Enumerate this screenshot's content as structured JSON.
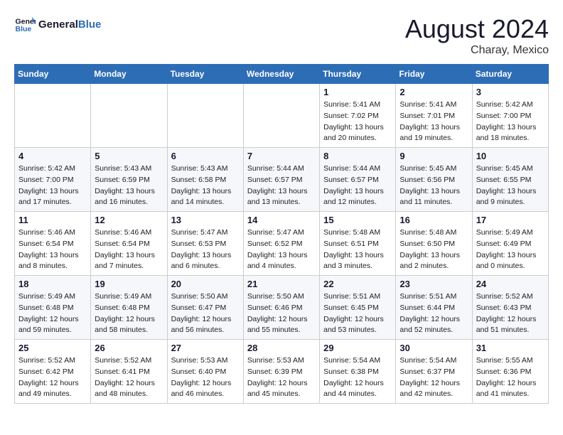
{
  "header": {
    "logo_general": "General",
    "logo_blue": "Blue",
    "month_year": "August 2024",
    "location": "Charay, Mexico"
  },
  "days_of_week": [
    "Sunday",
    "Monday",
    "Tuesday",
    "Wednesday",
    "Thursday",
    "Friday",
    "Saturday"
  ],
  "weeks": [
    [
      {
        "day": "",
        "sunrise": "",
        "sunset": "",
        "daylight": ""
      },
      {
        "day": "",
        "sunrise": "",
        "sunset": "",
        "daylight": ""
      },
      {
        "day": "",
        "sunrise": "",
        "sunset": "",
        "daylight": ""
      },
      {
        "day": "",
        "sunrise": "",
        "sunset": "",
        "daylight": ""
      },
      {
        "day": "1",
        "sunrise": "Sunrise: 5:41 AM",
        "sunset": "Sunset: 7:02 PM",
        "daylight": "Daylight: 13 hours and 20 minutes."
      },
      {
        "day": "2",
        "sunrise": "Sunrise: 5:41 AM",
        "sunset": "Sunset: 7:01 PM",
        "daylight": "Daylight: 13 hours and 19 minutes."
      },
      {
        "day": "3",
        "sunrise": "Sunrise: 5:42 AM",
        "sunset": "Sunset: 7:00 PM",
        "daylight": "Daylight: 13 hours and 18 minutes."
      }
    ],
    [
      {
        "day": "4",
        "sunrise": "Sunrise: 5:42 AM",
        "sunset": "Sunset: 7:00 PM",
        "daylight": "Daylight: 13 hours and 17 minutes."
      },
      {
        "day": "5",
        "sunrise": "Sunrise: 5:43 AM",
        "sunset": "Sunset: 6:59 PM",
        "daylight": "Daylight: 13 hours and 16 minutes."
      },
      {
        "day": "6",
        "sunrise": "Sunrise: 5:43 AM",
        "sunset": "Sunset: 6:58 PM",
        "daylight": "Daylight: 13 hours and 14 minutes."
      },
      {
        "day": "7",
        "sunrise": "Sunrise: 5:44 AM",
        "sunset": "Sunset: 6:57 PM",
        "daylight": "Daylight: 13 hours and 13 minutes."
      },
      {
        "day": "8",
        "sunrise": "Sunrise: 5:44 AM",
        "sunset": "Sunset: 6:57 PM",
        "daylight": "Daylight: 13 hours and 12 minutes."
      },
      {
        "day": "9",
        "sunrise": "Sunrise: 5:45 AM",
        "sunset": "Sunset: 6:56 PM",
        "daylight": "Daylight: 13 hours and 11 minutes."
      },
      {
        "day": "10",
        "sunrise": "Sunrise: 5:45 AM",
        "sunset": "Sunset: 6:55 PM",
        "daylight": "Daylight: 13 hours and 9 minutes."
      }
    ],
    [
      {
        "day": "11",
        "sunrise": "Sunrise: 5:46 AM",
        "sunset": "Sunset: 6:54 PM",
        "daylight": "Daylight: 13 hours and 8 minutes."
      },
      {
        "day": "12",
        "sunrise": "Sunrise: 5:46 AM",
        "sunset": "Sunset: 6:54 PM",
        "daylight": "Daylight: 13 hours and 7 minutes."
      },
      {
        "day": "13",
        "sunrise": "Sunrise: 5:47 AM",
        "sunset": "Sunset: 6:53 PM",
        "daylight": "Daylight: 13 hours and 6 minutes."
      },
      {
        "day": "14",
        "sunrise": "Sunrise: 5:47 AM",
        "sunset": "Sunset: 6:52 PM",
        "daylight": "Daylight: 13 hours and 4 minutes."
      },
      {
        "day": "15",
        "sunrise": "Sunrise: 5:48 AM",
        "sunset": "Sunset: 6:51 PM",
        "daylight": "Daylight: 13 hours and 3 minutes."
      },
      {
        "day": "16",
        "sunrise": "Sunrise: 5:48 AM",
        "sunset": "Sunset: 6:50 PM",
        "daylight": "Daylight: 13 hours and 2 minutes."
      },
      {
        "day": "17",
        "sunrise": "Sunrise: 5:49 AM",
        "sunset": "Sunset: 6:49 PM",
        "daylight": "Daylight: 13 hours and 0 minutes."
      }
    ],
    [
      {
        "day": "18",
        "sunrise": "Sunrise: 5:49 AM",
        "sunset": "Sunset: 6:48 PM",
        "daylight": "Daylight: 12 hours and 59 minutes."
      },
      {
        "day": "19",
        "sunrise": "Sunrise: 5:49 AM",
        "sunset": "Sunset: 6:48 PM",
        "daylight": "Daylight: 12 hours and 58 minutes."
      },
      {
        "day": "20",
        "sunrise": "Sunrise: 5:50 AM",
        "sunset": "Sunset: 6:47 PM",
        "daylight": "Daylight: 12 hours and 56 minutes."
      },
      {
        "day": "21",
        "sunrise": "Sunrise: 5:50 AM",
        "sunset": "Sunset: 6:46 PM",
        "daylight": "Daylight: 12 hours and 55 minutes."
      },
      {
        "day": "22",
        "sunrise": "Sunrise: 5:51 AM",
        "sunset": "Sunset: 6:45 PM",
        "daylight": "Daylight: 12 hours and 53 minutes."
      },
      {
        "day": "23",
        "sunrise": "Sunrise: 5:51 AM",
        "sunset": "Sunset: 6:44 PM",
        "daylight": "Daylight: 12 hours and 52 minutes."
      },
      {
        "day": "24",
        "sunrise": "Sunrise: 5:52 AM",
        "sunset": "Sunset: 6:43 PM",
        "daylight": "Daylight: 12 hours and 51 minutes."
      }
    ],
    [
      {
        "day": "25",
        "sunrise": "Sunrise: 5:52 AM",
        "sunset": "Sunset: 6:42 PM",
        "daylight": "Daylight: 12 hours and 49 minutes."
      },
      {
        "day": "26",
        "sunrise": "Sunrise: 5:52 AM",
        "sunset": "Sunset: 6:41 PM",
        "daylight": "Daylight: 12 hours and 48 minutes."
      },
      {
        "day": "27",
        "sunrise": "Sunrise: 5:53 AM",
        "sunset": "Sunset: 6:40 PM",
        "daylight": "Daylight: 12 hours and 46 minutes."
      },
      {
        "day": "28",
        "sunrise": "Sunrise: 5:53 AM",
        "sunset": "Sunset: 6:39 PM",
        "daylight": "Daylight: 12 hours and 45 minutes."
      },
      {
        "day": "29",
        "sunrise": "Sunrise: 5:54 AM",
        "sunset": "Sunset: 6:38 PM",
        "daylight": "Daylight: 12 hours and 44 minutes."
      },
      {
        "day": "30",
        "sunrise": "Sunrise: 5:54 AM",
        "sunset": "Sunset: 6:37 PM",
        "daylight": "Daylight: 12 hours and 42 minutes."
      },
      {
        "day": "31",
        "sunrise": "Sunrise: 5:55 AM",
        "sunset": "Sunset: 6:36 PM",
        "daylight": "Daylight: 12 hours and 41 minutes."
      }
    ]
  ]
}
